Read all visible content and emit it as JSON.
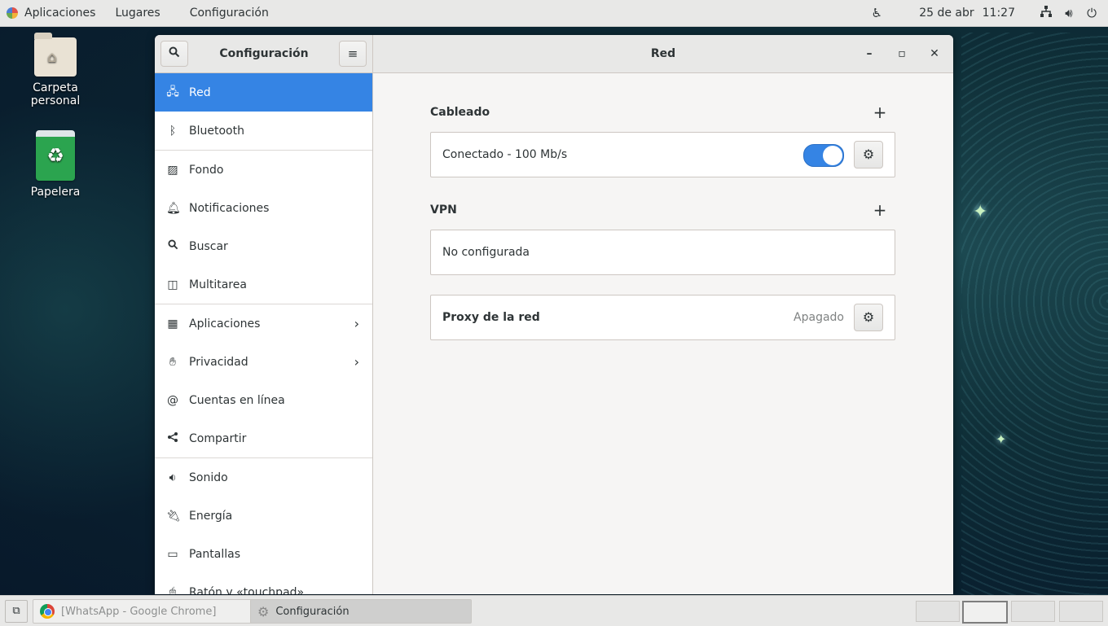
{
  "topbar": {
    "apps_label": "Aplicaciones",
    "places_label": "Lugares",
    "active_app_label": "Configuración",
    "date": "25 de abr",
    "time": "11:27"
  },
  "desktop": {
    "icons": [
      {
        "label": "Carpeta personal"
      },
      {
        "label": "Papelera"
      }
    ]
  },
  "window": {
    "sidebar_title": "Configuración",
    "panel_title": "Red"
  },
  "sidebar": {
    "items": [
      {
        "label": "Red",
        "icon": "network-icon"
      },
      {
        "label": "Bluetooth",
        "icon": "bluetooth-icon"
      },
      {
        "label": "Fondo",
        "icon": "image-icon"
      },
      {
        "label": "Notificaciones",
        "icon": "bell-icon"
      },
      {
        "label": "Buscar",
        "icon": "search-icon"
      },
      {
        "label": "Multitarea",
        "icon": "multitask-icon"
      },
      {
        "label": "Aplicaciones",
        "icon": "grid-icon"
      },
      {
        "label": "Privacidad",
        "icon": "hand-icon"
      },
      {
        "label": "Cuentas en línea",
        "icon": "at-icon"
      },
      {
        "label": "Compartir",
        "icon": "share-icon"
      },
      {
        "label": "Sonido",
        "icon": "speaker-icon"
      },
      {
        "label": "Energía",
        "icon": "battery-icon"
      },
      {
        "label": "Pantallas",
        "icon": "monitor-icon"
      },
      {
        "label": "Ratón y «touchpad»",
        "icon": "mouse-icon"
      }
    ]
  },
  "content": {
    "wired": {
      "title": "Cableado",
      "status": "Conectado - 100 Mb/s",
      "enabled": true
    },
    "vpn": {
      "title": "VPN",
      "status": "No configurada"
    },
    "proxy": {
      "label": "Proxy de la red",
      "status": "Apagado"
    }
  },
  "taskbar": {
    "tasks": [
      {
        "label": "[WhatsApp - Google Chrome]"
      },
      {
        "label": "Configuración"
      }
    ]
  },
  "colors": {
    "accent": "#3584e4"
  }
}
